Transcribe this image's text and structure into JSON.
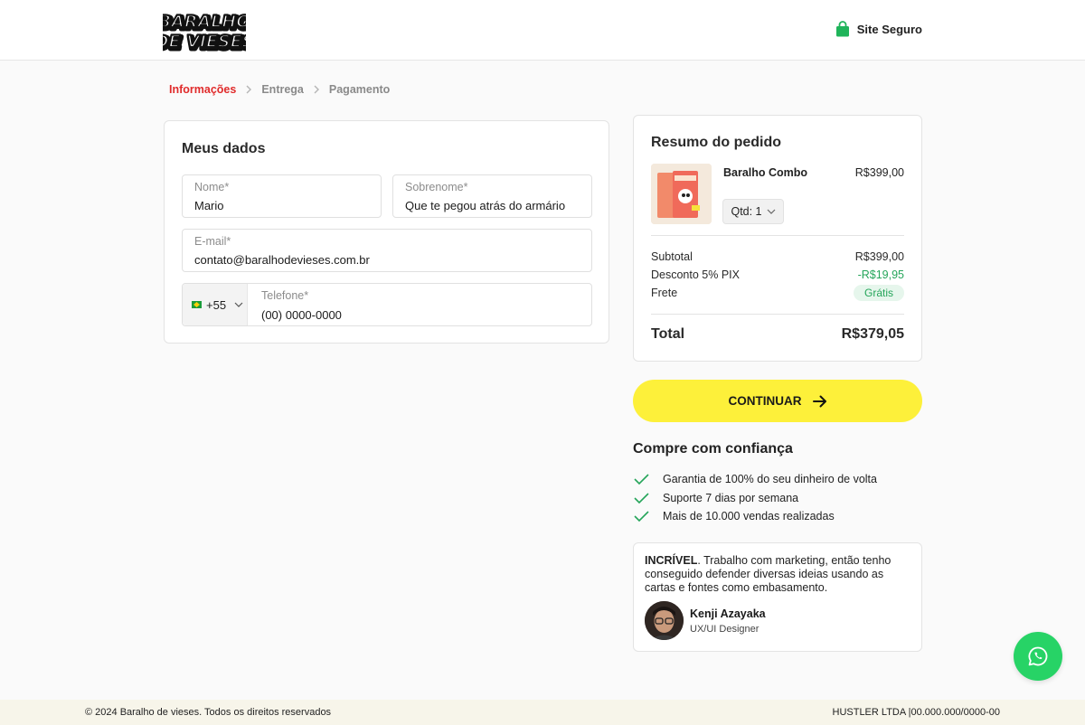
{
  "header": {
    "logo_line1": "BARALHO",
    "logo_line2": "DE VIESES",
    "secure_label": "Site Seguro"
  },
  "breadcrumb": {
    "steps": [
      "Informações",
      "Entrega",
      "Pagamento"
    ],
    "active_index": 0
  },
  "form": {
    "title": "Meus dados",
    "first_name": {
      "label": "Nome*",
      "value": "Mario"
    },
    "last_name": {
      "label": "Sobrenome*",
      "value": "Que te pegou atrás do armário"
    },
    "email": {
      "label": "E-mail*",
      "value": "contato@baralhodevieses.com.br"
    },
    "phone": {
      "country_code": "+55",
      "label": "Telefone*",
      "value": "(00) 0000-0000"
    }
  },
  "summary": {
    "title": "Resumo do pedido",
    "product": {
      "name": "Baralho Combo",
      "price": "R$399,00",
      "qty_label": "Qtd: 1"
    },
    "subtotal_label": "Subtotal",
    "subtotal_value": "R$399,00",
    "discount_label": "Desconto 5% PIX",
    "discount_value": "-R$19,95",
    "shipping_label": "Frete",
    "shipping_value": "Grátis",
    "total_label": "Total",
    "total_value": "R$379,05"
  },
  "cta": {
    "label": "CONTINUAR"
  },
  "trust": {
    "title": "Compre com confiança",
    "items": [
      "Garantia de 100% do seu dinheiro de volta",
      "Suporte 7 dias por semana",
      "Mais de 10.000 vendas realizadas"
    ]
  },
  "testimonial": {
    "highlight": "INCRÍVEL",
    "text": ". Trabalho com marketing, então tenho conseguido defender diversas ideias usando as cartas e fontes como embasamento.",
    "name": "Kenji Azayaka",
    "role": "UX/UI Designer"
  },
  "footer": {
    "copyright": "© 2024 Baralho de vieses. Todos os direitos reservados",
    "company": "HUSTLER LTDA |00.000.000/0000-00"
  },
  "colors": {
    "accent_red": "#e02b2b",
    "cta_yellow": "#fdf03a",
    "success_green": "#25a55a",
    "whatsapp_green": "#27d366"
  },
  "icons": {
    "secure": "lock-bag-icon",
    "breadcrumb_sep": "chevron-right-icon",
    "qty_dropdown": "chevron-down-icon",
    "cta": "arrow-right-icon",
    "trust": "check-icon",
    "chat": "whatsapp-icon"
  }
}
